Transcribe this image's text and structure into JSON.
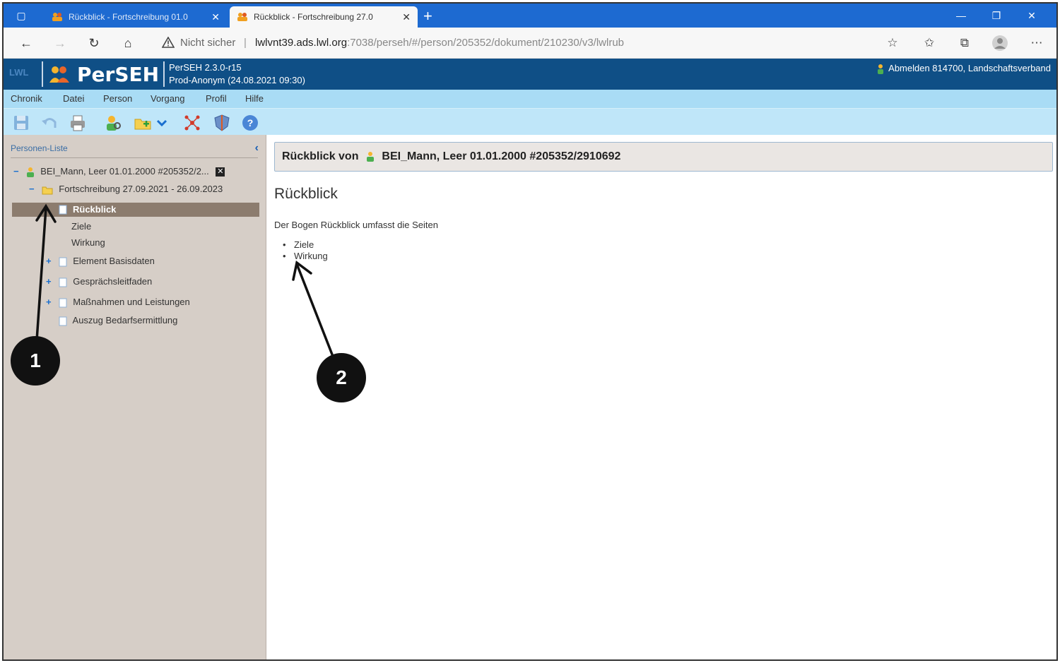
{
  "browser": {
    "tabs": [
      {
        "title": "Rückblick - Fortschreibung 01.0",
        "active": false
      },
      {
        "title": "Rückblick - Fortschreibung 27.0",
        "active": true
      }
    ],
    "new_tab": "+",
    "address": {
      "security_label": "Nicht sicher",
      "separator": "|",
      "host": "lwlvnt39.ads.lwl.org",
      "path": ":7038/perseh/#/person/205352/dokument/210230/v3/lwlrub"
    }
  },
  "app": {
    "org_logo": "LWL",
    "title": "PerSEH",
    "version": "PerSEH 2.3.0-r15",
    "environment": "Prod-Anonym (24.08.2021 09:30)",
    "logout": "Abmelden 814700, Landschaftsverband",
    "colors": {
      "header": "#0f4f86",
      "menubar": "#a9dcf5",
      "toolbar": "#bfe6f9",
      "sidebar": "#d6cec7",
      "selected": "#8c7c6e"
    }
  },
  "menu": [
    "Chronik",
    "Datei",
    "Person",
    "Vorgang",
    "Profil",
    "Hilfe"
  ],
  "toolbar_icons": [
    "save-icon",
    "undo-icon",
    "print-icon",
    "person-search-icon",
    "add-folder-icon",
    "dropdown-chevron-icon",
    "network-icon",
    "shield-icon",
    "help-icon"
  ],
  "sidebar": {
    "heading": "Personen-Liste",
    "person": "BEI_Mann, Leer 01.01.2000 #205352/2...",
    "process": "Fortschreibung 27.09.2021 - 26.09.2023",
    "selected": "Rückblick",
    "sub_pages": [
      "Ziele",
      "Wirkung"
    ],
    "documents": [
      {
        "label": "Element Basisdaten",
        "expandable": true
      },
      {
        "label": "Gesprächsleitfaden",
        "expandable": true
      },
      {
        "label": "Maßnahmen und Leistungen",
        "expandable": true
      },
      {
        "label": "Auszug Bedarfsermittlung",
        "expandable": false
      }
    ]
  },
  "content": {
    "header_prefix": "Rückblick von",
    "header_person": "BEI_Mann, Leer 01.01.2000 #205352/2910692",
    "title": "Rückblick",
    "description": "Der Bogen Rückblick umfasst die Seiten",
    "pages": [
      "Ziele",
      "Wirkung"
    ]
  },
  "callouts": [
    "1",
    "2"
  ]
}
